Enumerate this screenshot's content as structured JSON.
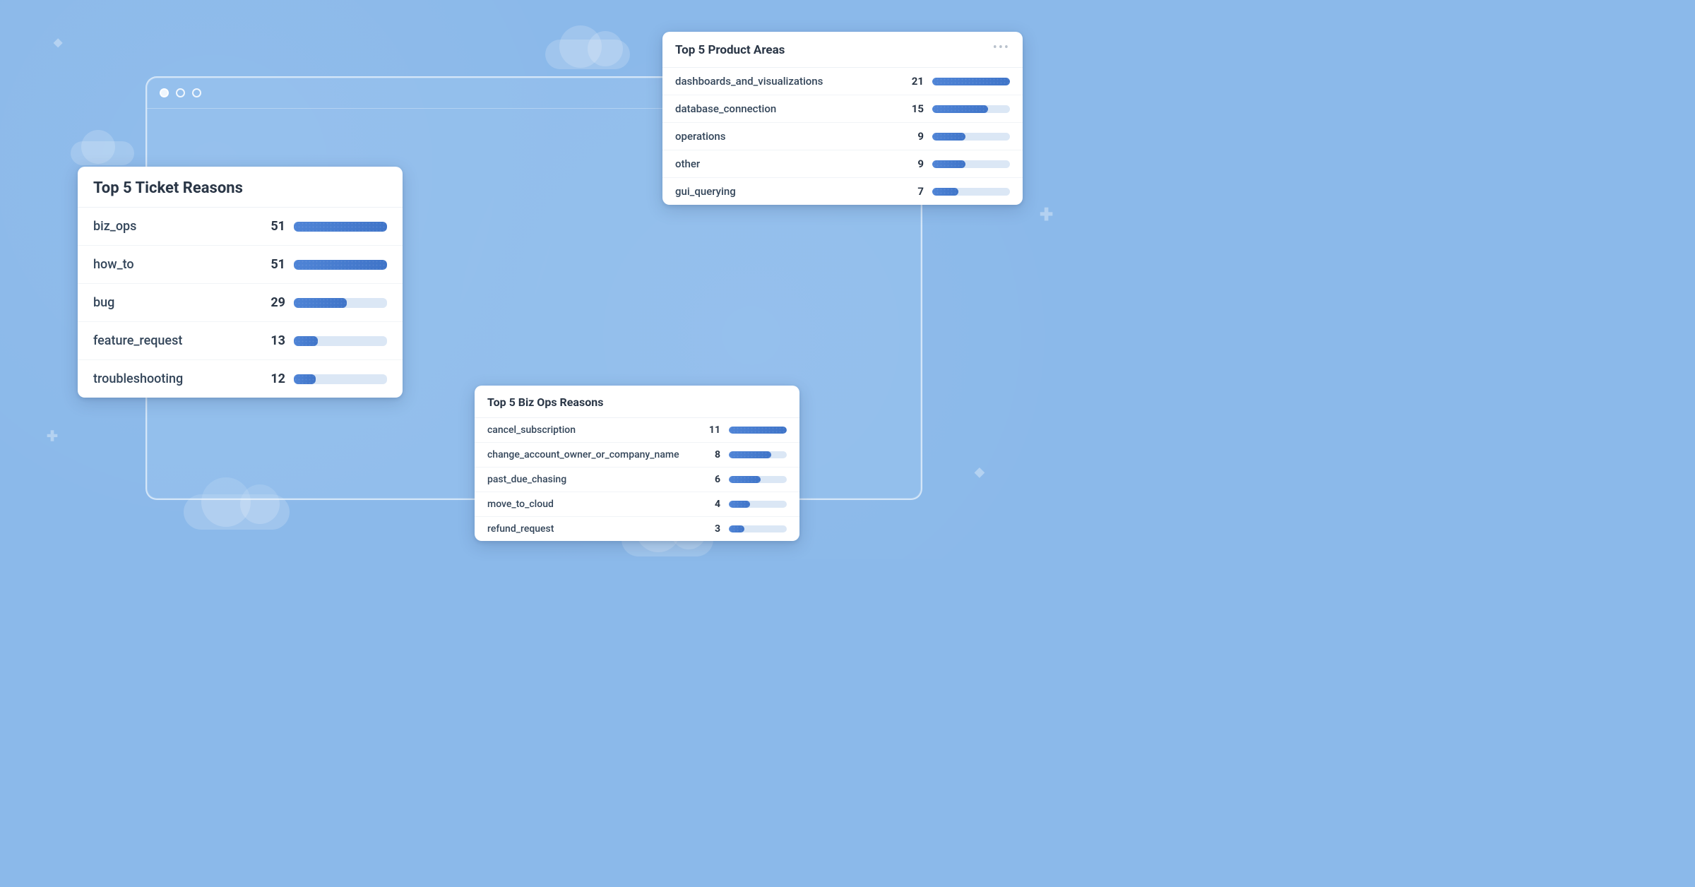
{
  "cards": {
    "ticket": {
      "title": "Top 5 Ticket Reasons",
      "rows": [
        {
          "label": "biz_ops",
          "value": 51
        },
        {
          "label": "how_to",
          "value": 51
        },
        {
          "label": "bug",
          "value": 29
        },
        {
          "label": "feature_request",
          "value": 13
        },
        {
          "label": "troubleshooting",
          "value": 12
        }
      ]
    },
    "product": {
      "title": "Top 5 Product Areas",
      "rows": [
        {
          "label": "dashboards_and_visualizations",
          "value": 21
        },
        {
          "label": "database_connection",
          "value": 15
        },
        {
          "label": "operations",
          "value": 9
        },
        {
          "label": "other",
          "value": 9
        },
        {
          "label": "gui_querying",
          "value": 7
        }
      ]
    },
    "bizops": {
      "title": "Top 5 Biz Ops Reasons",
      "rows": [
        {
          "label": "cancel_subscription",
          "value": 11
        },
        {
          "label": "change_account_owner_or_company_name",
          "value": 8
        },
        {
          "label": "past_due_chasing",
          "value": 6
        },
        {
          "label": "move_to_cloud",
          "value": 4
        },
        {
          "label": "refund_request",
          "value": 3
        }
      ]
    }
  },
  "chart_data": [
    {
      "type": "bar",
      "title": "Top 5 Ticket Reasons",
      "categories": [
        "biz_ops",
        "how_to",
        "bug",
        "feature_request",
        "troubleshooting"
      ],
      "values": [
        51,
        51,
        29,
        13,
        12
      ],
      "xlabel": "",
      "ylabel": "",
      "ylim": [
        0,
        51
      ]
    },
    {
      "type": "bar",
      "title": "Top 5 Product Areas",
      "categories": [
        "dashboards_and_visualizations",
        "database_connection",
        "operations",
        "other",
        "gui_querying"
      ],
      "values": [
        21,
        15,
        9,
        9,
        7
      ],
      "xlabel": "",
      "ylabel": "",
      "ylim": [
        0,
        21
      ]
    },
    {
      "type": "bar",
      "title": "Top 5 Biz Ops Reasons",
      "categories": [
        "cancel_subscription",
        "change_account_owner_or_company_name",
        "past_due_chasing",
        "move_to_cloud",
        "refund_request"
      ],
      "values": [
        11,
        8,
        6,
        4,
        3
      ],
      "xlabel": "",
      "ylabel": "",
      "ylim": [
        0,
        11
      ]
    }
  ]
}
